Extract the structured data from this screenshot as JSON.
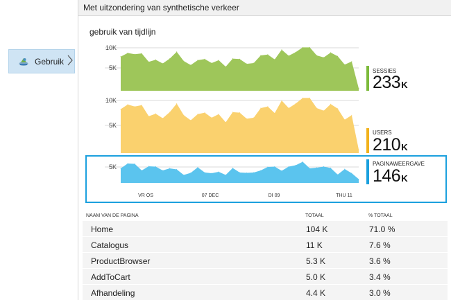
{
  "nav": {
    "label": "Gebruik",
    "icon": "usage-icon",
    "chevron": "chevron-right-icon"
  },
  "blade": {
    "title": "Met uitzondering van synthetische verkeer"
  },
  "chart_title": "gebruik van tijdlijn",
  "kpis": [
    {
      "name": "SESSIES",
      "value": "233",
      "unit": "K",
      "color": "#7cba3b"
    },
    {
      "name": "USERS",
      "value": "210",
      "unit": "K",
      "color": "#f2b21c"
    },
    {
      "name": "PAGINAWEERGAVE",
      "value": "146",
      "unit": "K",
      "color": "#1ba0de"
    }
  ],
  "chart_data": [
    {
      "type": "area",
      "series": [
        {
          "name": "SESSIES",
          "values": [
            8.5,
            9.4,
            9.1,
            9.3,
            7.2,
            7.7,
            6.8,
            8.0,
            9.7,
            7.4,
            6.4,
            7.6,
            7.9,
            6.9,
            7.6,
            6.0,
            8.0,
            7.9,
            6.7,
            6.9,
            8.8,
            9.0,
            7.8,
            10.2,
            8.7,
            9.6,
            10.8,
            10.8,
            8.8,
            8.3,
            9.5,
            8.6,
            6.5,
            7.3,
            0.6
          ]
        }
      ],
      "ylim": [
        0,
        12
      ],
      "yticks": [
        "10K",
        "5K"
      ],
      "color": "#9ec65a"
    },
    {
      "type": "area",
      "series": [
        {
          "name": "USERS",
          "values": [
            8.7,
            9.6,
            9.2,
            9.5,
            7.3,
            7.8,
            6.9,
            8.1,
            9.8,
            7.5,
            6.5,
            7.7,
            8.0,
            7.0,
            7.7,
            6.1,
            8.1,
            8.0,
            6.8,
            7.0,
            8.9,
            9.2,
            7.9,
            10.4,
            8.9,
            9.8,
            10.9,
            10.9,
            8.9,
            8.4,
            9.7,
            8.8,
            6.6,
            7.5,
            0.7
          ]
        }
      ],
      "ylim": [
        0,
        12
      ],
      "yticks": [
        "10K",
        "5K"
      ],
      "color": "#fad16e"
    },
    {
      "type": "area",
      "series": [
        {
          "name": "PAGINAWEERGAVE",
          "values": [
            4.2,
            5.6,
            5.5,
            3.6,
            4.8,
            4.7,
            3.6,
            4.2,
            3.9,
            2.3,
            2.9,
            4.5,
            3.0,
            2.8,
            3.2,
            2.3,
            4.3,
            3.0,
            2.9,
            3.0,
            3.6,
            4.6,
            4.7,
            3.5,
            4.7,
            5.1,
            6.1,
            4.2,
            4.4,
            4.7,
            4.3,
            2.4,
            4.0,
            2.8,
            1.1
          ]
        }
      ],
      "ylim": [
        0,
        7
      ],
      "yticks": [
        "5K"
      ],
      "color": "#5bc4ee"
    }
  ],
  "xticks": [
    "VR OS",
    "07 DEC",
    "DI 09",
    "THU 11"
  ],
  "table": {
    "headers": [
      "NAAM VAN DE PAGINA",
      "TOTAAL",
      "% TOTAAL"
    ],
    "rows": [
      [
        "Home",
        "104 K",
        "71.0 %"
      ],
      [
        "Catalogus",
        "11 K",
        "7.6 %"
      ],
      [
        "ProductBrowser",
        "5.3 K",
        "3.6 %"
      ],
      [
        "AddToCart",
        "5.0 K",
        "3.4 %"
      ],
      [
        "Afhandeling",
        "4.4 K",
        "3.0 %"
      ]
    ]
  }
}
